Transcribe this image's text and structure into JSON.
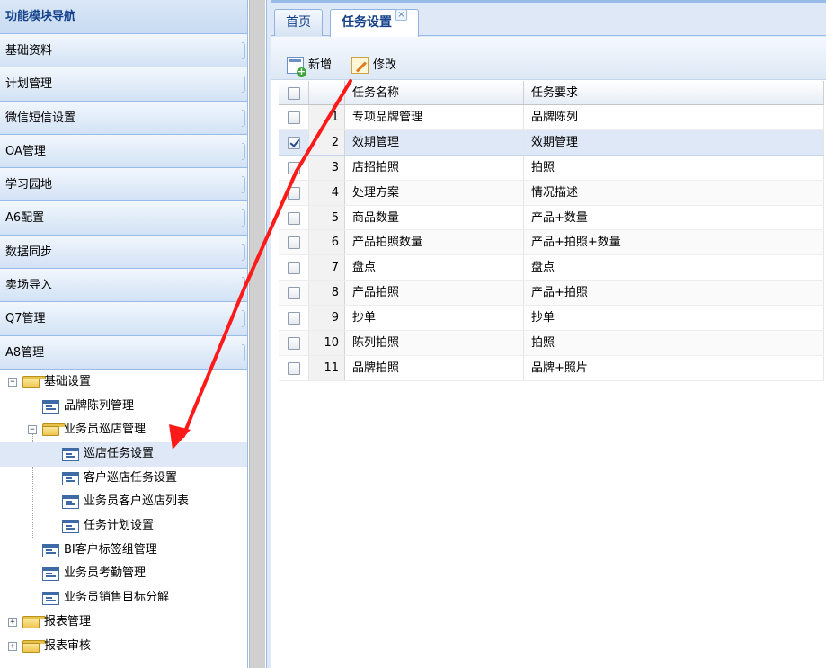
{
  "nav": {
    "title": "功能模块导航",
    "accordion": [
      "基础资料",
      "计划管理",
      "微信短信设置",
      "OA管理",
      "学习园地",
      "A6配置",
      "数据同步",
      "卖场导入",
      "Q7管理",
      "A8管理"
    ],
    "tree": {
      "basic_settings": "基础设置",
      "brand_display": "品牌陈列管理",
      "patrol_mgmt": "业务员巡店管理",
      "patrol_task_settings": "巡店任务设置",
      "customer_patrol_task": "客户巡店任务设置",
      "salesman_customer_list": "业务员客户巡店列表",
      "task_plan_settings": "任务计划设置",
      "bi_tag_group": "BI客户标签组管理",
      "attendance": "业务员考勤管理",
      "sales_target": "业务员销售目标分解",
      "report_mgmt": "报表管理",
      "report_audit": "报表审核"
    }
  },
  "tabs": {
    "home": "首页",
    "task_settings": "任务设置",
    "close_glyph": "×"
  },
  "toolbar": {
    "add": "新增",
    "edit": "修改"
  },
  "grid": {
    "headers": {
      "name": "任务名称",
      "requirement": "任务要求"
    },
    "rows": [
      {
        "num": "1",
        "name": "专项品牌管理",
        "req": "品牌陈列"
      },
      {
        "num": "2",
        "name": "效期管理",
        "req": "效期管理"
      },
      {
        "num": "3",
        "name": "店招拍照",
        "req": "拍照"
      },
      {
        "num": "4",
        "name": "处理方案",
        "req": "情况描述"
      },
      {
        "num": "5",
        "name": "商品数量",
        "req": "产品+数量"
      },
      {
        "num": "6",
        "name": "产品拍照数量",
        "req": "产品+拍照+数量"
      },
      {
        "num": "7",
        "name": "盘点",
        "req": "盘点"
      },
      {
        "num": "8",
        "name": "产品拍照",
        "req": "产品+拍照"
      },
      {
        "num": "9",
        "name": "抄单",
        "req": "抄单"
      },
      {
        "num": "10",
        "name": "陈列拍照",
        "req": "拍照"
      },
      {
        "num": "11",
        "name": "品牌拍照",
        "req": "品牌+照片"
      }
    ]
  },
  "colors": {
    "accent": "#15428b",
    "border": "#99bbe8",
    "selection": "#dfe8f6",
    "annotation": "#ff1a1a"
  }
}
